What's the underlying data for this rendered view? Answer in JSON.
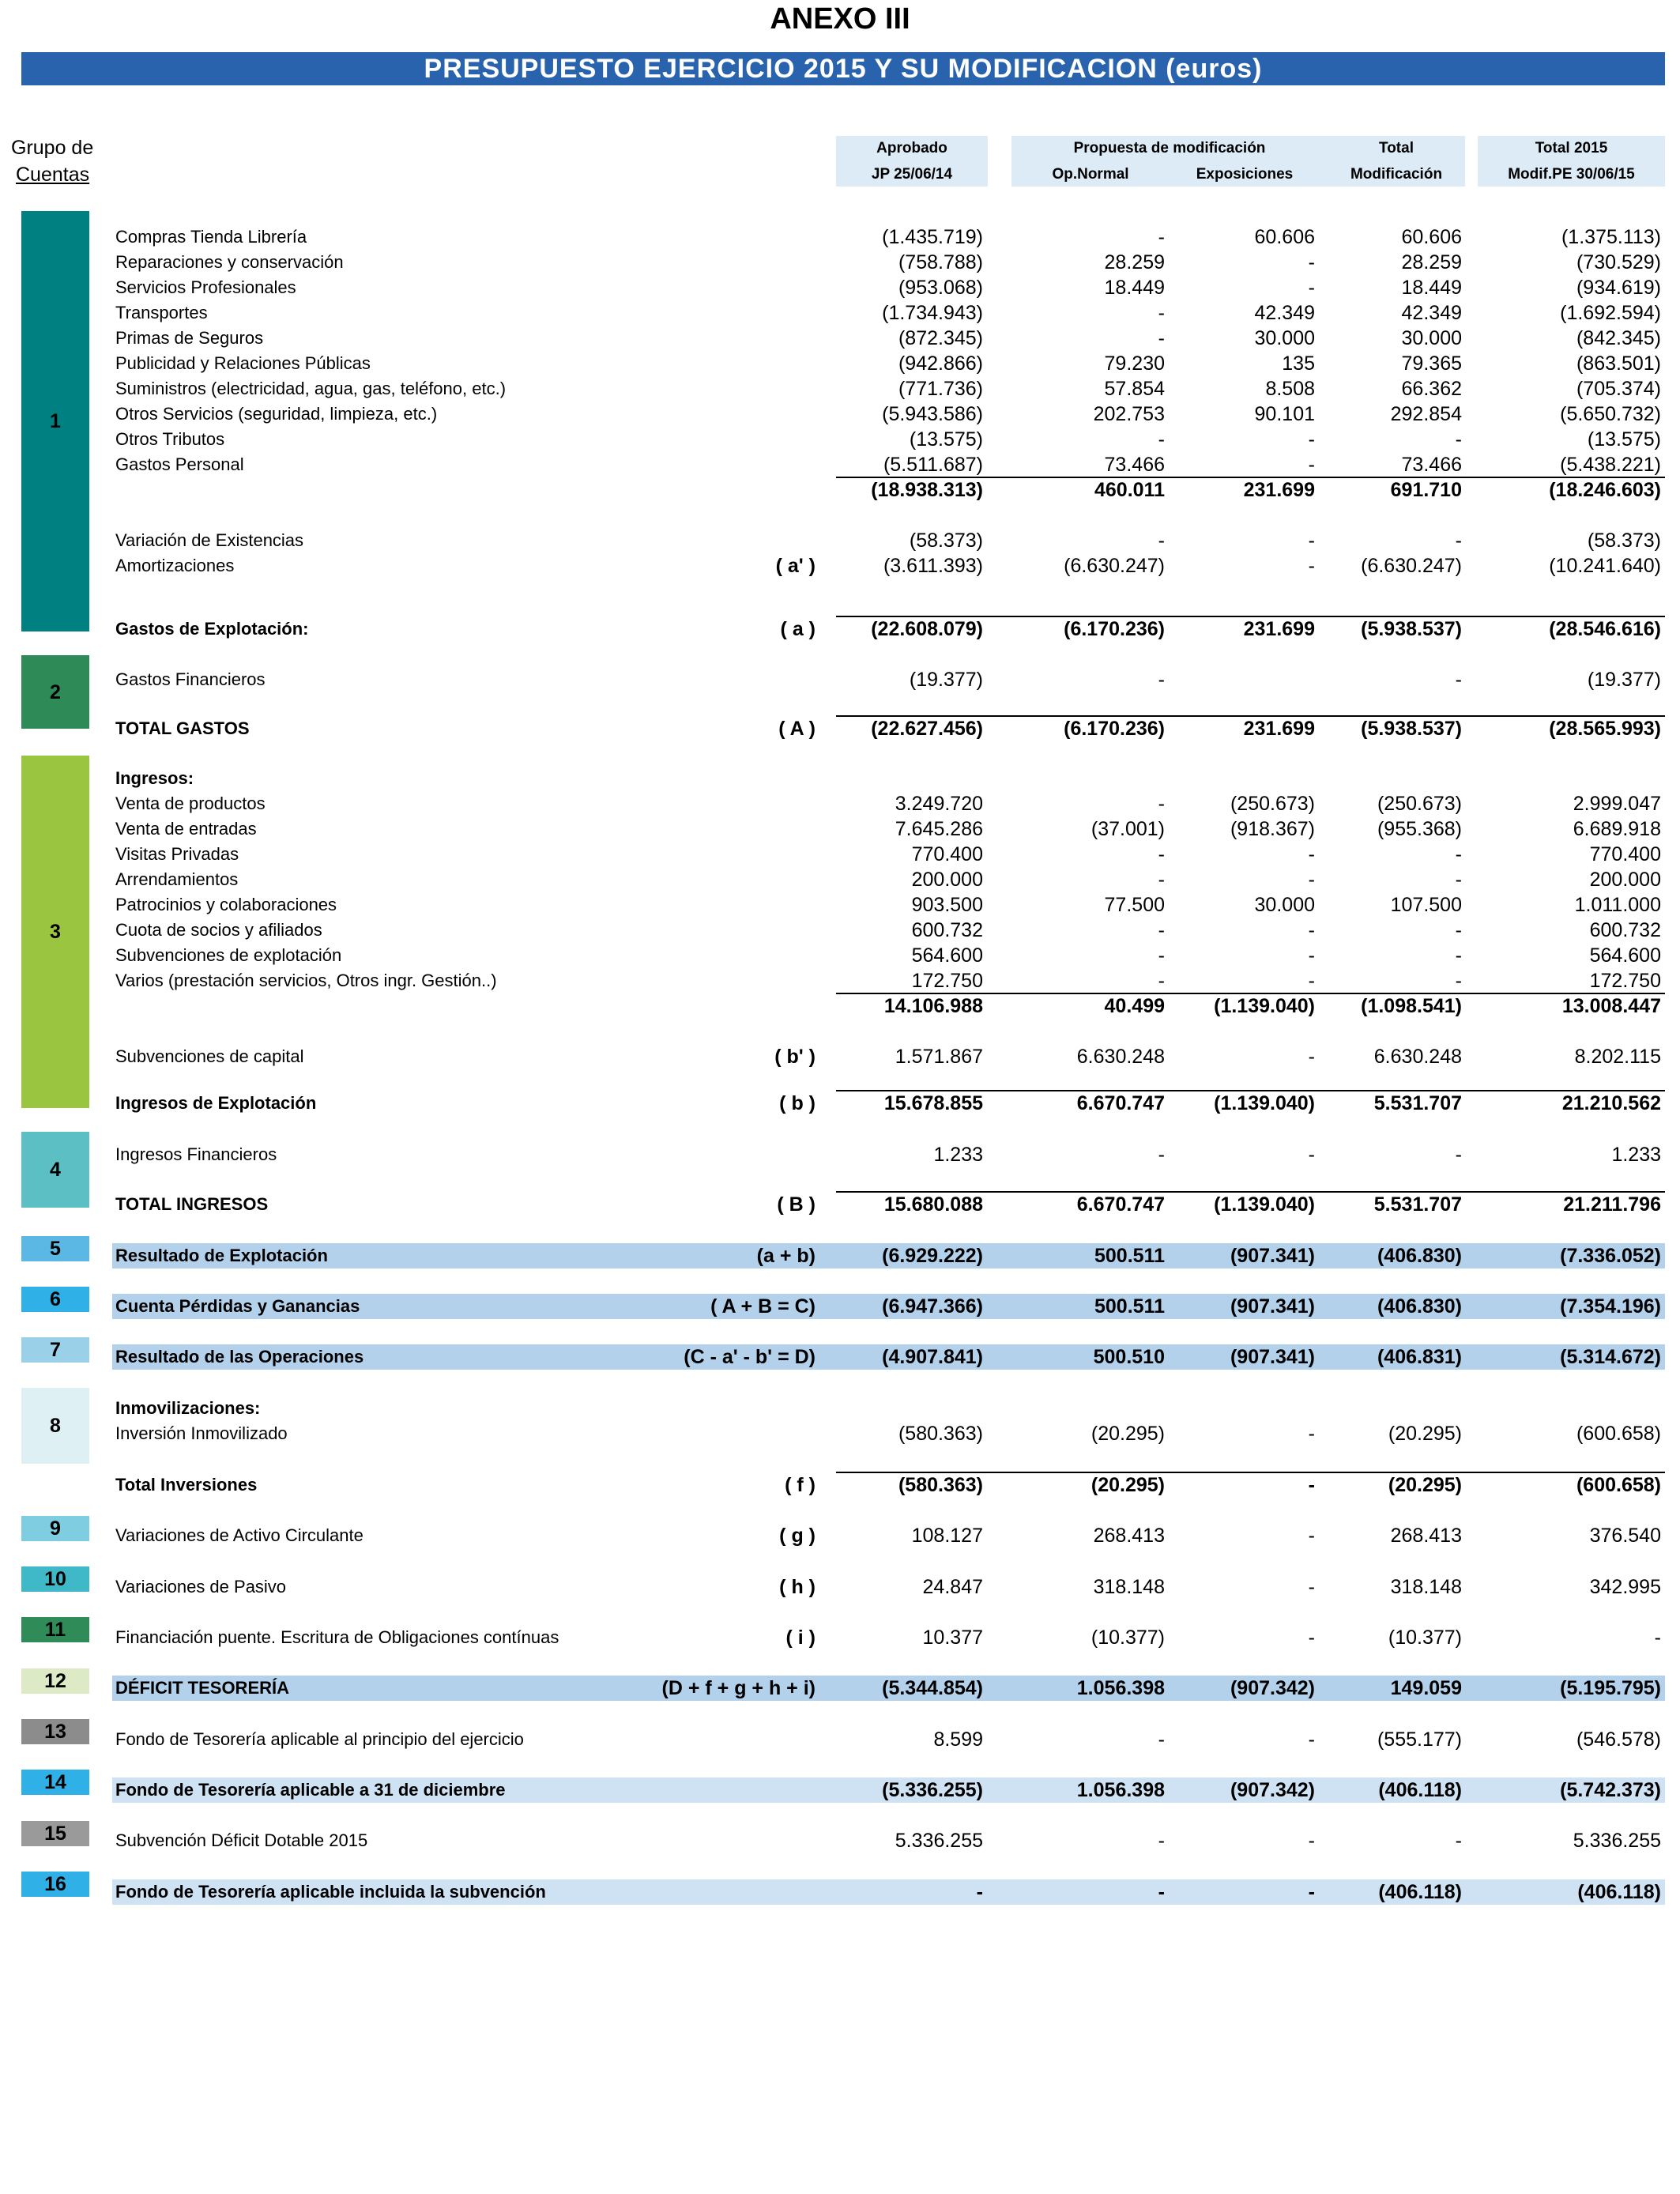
{
  "title": "ANEXO III",
  "banner": "PRESUPUESTO  EJERCICIO  2015   Y SU MODIFICACION   (euros)",
  "grupo_label": {
    "line1": "Grupo de",
    "line2": "Cuentas"
  },
  "headers": {
    "aprobado_1": "Aprobado",
    "aprobado_2": "JP 25/06/14",
    "propuesta": "Propuesta de modificación",
    "op_normal": "Op.Normal",
    "exposiciones": "Exposiciones",
    "total_mod_1": "Total",
    "total_mod_2": "Modificación",
    "total_2015_1": "Total 2015",
    "total_2015_2": "Modif.PE 30/06/15"
  },
  "groups": [
    {
      "label": "1",
      "color": "#008080"
    },
    {
      "label": "2",
      "color": "#2e8b57"
    },
    {
      "label": "3",
      "color": "#9ac540"
    },
    {
      "label": "4",
      "color": "#5bbfc4"
    },
    {
      "label": "5",
      "color": "#5bb8e4"
    },
    {
      "label": "6",
      "color": "#2fb0e6"
    },
    {
      "label": "7",
      "color": "#9ad0e8"
    },
    {
      "label": "8",
      "color": "#dff0f5"
    },
    {
      "label": "9",
      "color": "#7fcde0"
    },
    {
      "label": "10",
      "color": "#3fb9c8"
    },
    {
      "label": "11",
      "color": "#2f8b57"
    },
    {
      "label": "12",
      "color": "#dcebc6"
    },
    {
      "label": "13",
      "color": "#8c8c8c"
    },
    {
      "label": "14",
      "color": "#2fb0e6"
    },
    {
      "label": "15",
      "color": "#9a9a9a"
    },
    {
      "label": "16",
      "color": "#2fb0e6"
    }
  ],
  "rows": [
    {
      "label": "Compras Tienda Librería",
      "key": "",
      "vals": [
        "(1.435.719)",
        "-",
        "60.606",
        "60.606",
        "(1.375.113)"
      ]
    },
    {
      "label": "Reparaciones y conservación",
      "key": "",
      "vals": [
        "(758.788)",
        "28.259",
        "-",
        "28.259",
        "(730.529)"
      ]
    },
    {
      "label": "Servicios Profesionales",
      "key": "",
      "vals": [
        "(953.068)",
        "18.449",
        "-",
        "18.449",
        "(934.619)"
      ]
    },
    {
      "label": "Transportes",
      "key": "",
      "vals": [
        "(1.734.943)",
        "-",
        "42.349",
        "42.349",
        "(1.692.594)"
      ]
    },
    {
      "label": "Primas de Seguros",
      "key": "",
      "vals": [
        "(872.345)",
        "-",
        "30.000",
        "30.000",
        "(842.345)"
      ]
    },
    {
      "label": "Publicidad y Relaciones Públicas",
      "key": "",
      "vals": [
        "(942.866)",
        "79.230",
        "135",
        "79.365",
        "(863.501)"
      ]
    },
    {
      "label": "Suministros (electricidad, agua, gas, teléfono, etc.)",
      "key": "",
      "vals": [
        "(771.736)",
        "57.854",
        "8.508",
        "66.362",
        "(705.374)"
      ]
    },
    {
      "label": "Otros Servicios (seguridad, limpieza, etc.)",
      "key": "",
      "vals": [
        "(5.943.586)",
        "202.753",
        "90.101",
        "292.854",
        "(5.650.732)"
      ]
    },
    {
      "label": "Otros Tributos",
      "key": "",
      "vals": [
        "(13.575)",
        "-",
        "-",
        "-",
        "(13.575)"
      ]
    },
    {
      "label": "Gastos Personal",
      "key": "",
      "vals": [
        "(5.511.687)",
        "73.466",
        "-",
        "73.466",
        "(5.438.221)"
      ]
    },
    {
      "label": "",
      "key": "",
      "vals": [
        "(18.938.313)",
        "460.011",
        "231.699",
        "691.710",
        "(18.246.603)"
      ]
    },
    {
      "label": "Variación de Existencias",
      "key": "",
      "vals": [
        "(58.373)",
        "-",
        "-",
        "-",
        "(58.373)"
      ]
    },
    {
      "label": "Amortizaciones",
      "key": "( a' )",
      "vals": [
        "(3.611.393)",
        "(6.630.247)",
        "-",
        "(6.630.247)",
        "(10.241.640)"
      ]
    },
    {
      "label": "Gastos de Explotación:",
      "key": "( a )",
      "vals": [
        "(22.608.079)",
        "(6.170.236)",
        "231.699",
        "(5.938.537)",
        "(28.546.616)"
      ]
    },
    {
      "label": "Gastos Financieros",
      "key": "",
      "vals": [
        "(19.377)",
        "-",
        "",
        "-",
        "(19.377)"
      ]
    },
    {
      "label": "TOTAL GASTOS",
      "key": "( A )",
      "vals": [
        "(22.627.456)",
        "(6.170.236)",
        "231.699",
        "(5.938.537)",
        "(28.565.993)"
      ]
    },
    {
      "label": "Ingresos:",
      "key": "",
      "vals": [
        "",
        "",
        "",
        "",
        ""
      ]
    },
    {
      "label": "Venta de productos",
      "key": "",
      "vals": [
        "3.249.720",
        "-",
        "(250.673)",
        "(250.673)",
        "2.999.047"
      ]
    },
    {
      "label": "Venta de entradas",
      "key": "",
      "vals": [
        "7.645.286",
        "(37.001)",
        "(918.367)",
        "(955.368)",
        "6.689.918"
      ]
    },
    {
      "label": "Visitas Privadas",
      "key": "",
      "vals": [
        "770.400",
        "-",
        "-",
        "-",
        "770.400"
      ]
    },
    {
      "label": "Arrendamientos",
      "key": "",
      "vals": [
        "200.000",
        "-",
        "-",
        "-",
        "200.000"
      ]
    },
    {
      "label": "Patrocinios y colaboraciones",
      "key": "",
      "vals": [
        "903.500",
        "77.500",
        "30.000",
        "107.500",
        "1.011.000"
      ]
    },
    {
      "label": "Cuota de socios y afiliados",
      "key": "",
      "vals": [
        "600.732",
        "-",
        "-",
        "-",
        "600.732"
      ]
    },
    {
      "label": "Subvenciones  de explotación",
      "key": "",
      "vals": [
        "564.600",
        "-",
        "-",
        "-",
        "564.600"
      ]
    },
    {
      "label": "Varios (prestación servicios, Otros ingr. Gestión..)",
      "key": "",
      "vals": [
        "172.750",
        "-",
        "-",
        "-",
        "172.750"
      ]
    },
    {
      "label": "",
      "key": "",
      "vals": [
        "14.106.988",
        "40.499",
        "(1.139.040)",
        "(1.098.541)",
        "13.008.447"
      ]
    },
    {
      "label": "Subvenciones de capital",
      "key": "( b' )",
      "vals": [
        "1.571.867",
        "6.630.248",
        "-",
        "6.630.248",
        "8.202.115"
      ]
    },
    {
      "label": "Ingresos de Explotación",
      "key": "( b )",
      "vals": [
        "15.678.855",
        "6.670.747",
        "(1.139.040)",
        "5.531.707",
        "21.210.562"
      ]
    },
    {
      "label": "Ingresos Financieros",
      "key": "",
      "vals": [
        "1.233",
        "-",
        "-",
        "-",
        "1.233"
      ]
    },
    {
      "label": "TOTAL INGRESOS",
      "key": "( B )",
      "vals": [
        "15.680.088",
        "6.670.747",
        "(1.139.040)",
        "5.531.707",
        "21.211.796"
      ]
    },
    {
      "label": "Resultado de Explotación",
      "key": "(a + b)",
      "vals": [
        "(6.929.222)",
        "500.511",
        "(907.341)",
        "(406.830)",
        "(7.336.052)"
      ]
    },
    {
      "label": "Cuenta Pérdidas y Ganancias",
      "key": "( A + B = C)",
      "vals": [
        "(6.947.366)",
        "500.511",
        "(907.341)",
        "(406.830)",
        "(7.354.196)"
      ]
    },
    {
      "label": "Resultado de las Operaciones",
      "key": "(C - a' - b' = D)",
      "vals": [
        "(4.907.841)",
        "500.510",
        "(907.341)",
        "(406.831)",
        "(5.314.672)"
      ]
    },
    {
      "label": "Inmovilizaciones:",
      "key": "",
      "vals": [
        "",
        "",
        "",
        "",
        ""
      ]
    },
    {
      "label": "Inversión Inmovilizado",
      "key": "",
      "vals": [
        "(580.363)",
        "(20.295)",
        "-",
        "(20.295)",
        "(600.658)"
      ]
    },
    {
      "label": "Total Inversiones",
      "key": "( f )",
      "vals": [
        "(580.363)",
        "(20.295)",
        "-",
        "(20.295)",
        "(600.658)"
      ]
    },
    {
      "label": "Variaciones de Activo Circulante",
      "key": "( g )",
      "vals": [
        "108.127",
        "268.413",
        "-",
        "268.413",
        "376.540"
      ]
    },
    {
      "label": "Variaciones de Pasivo",
      "key": "( h )",
      "vals": [
        "24.847",
        "318.148",
        "-",
        "318.148",
        "342.995"
      ]
    },
    {
      "label": "Financiación puente. Escritura de Obligaciones contínuas",
      "key": "( i )",
      "vals": [
        "10.377",
        "(10.377)",
        "-",
        "(10.377)",
        "-"
      ]
    },
    {
      "label": "DÉFICIT TESORERÍA",
      "key": "(D + f + g + h + i)",
      "vals": [
        "(5.344.854)",
        "1.056.398",
        "(907.342)",
        "149.059",
        "(5.195.795)"
      ]
    },
    {
      "label": "Fondo de Tesorería aplicable al principio del ejercicio",
      "key": "",
      "vals": [
        "8.599",
        "-",
        "-",
        "(555.177)",
        "(546.578)"
      ]
    },
    {
      "label": "Fondo de Tesorería aplicable a 31 de diciembre",
      "key": "",
      "vals": [
        "(5.336.255)",
        "1.056.398",
        "(907.342)",
        "(406.118)",
        "(5.742.373)"
      ]
    },
    {
      "label": "Subvención Déficit Dotable 2015",
      "key": "",
      "vals": [
        "5.336.255",
        "-",
        "-",
        "-",
        "5.336.255"
      ]
    },
    {
      "label": "Fondo de Tesorería aplicable incluida la subvención",
      "key": "",
      "vals": [
        "-",
        "-",
        "-",
        "(406.118)",
        "(406.118)"
      ]
    }
  ]
}
